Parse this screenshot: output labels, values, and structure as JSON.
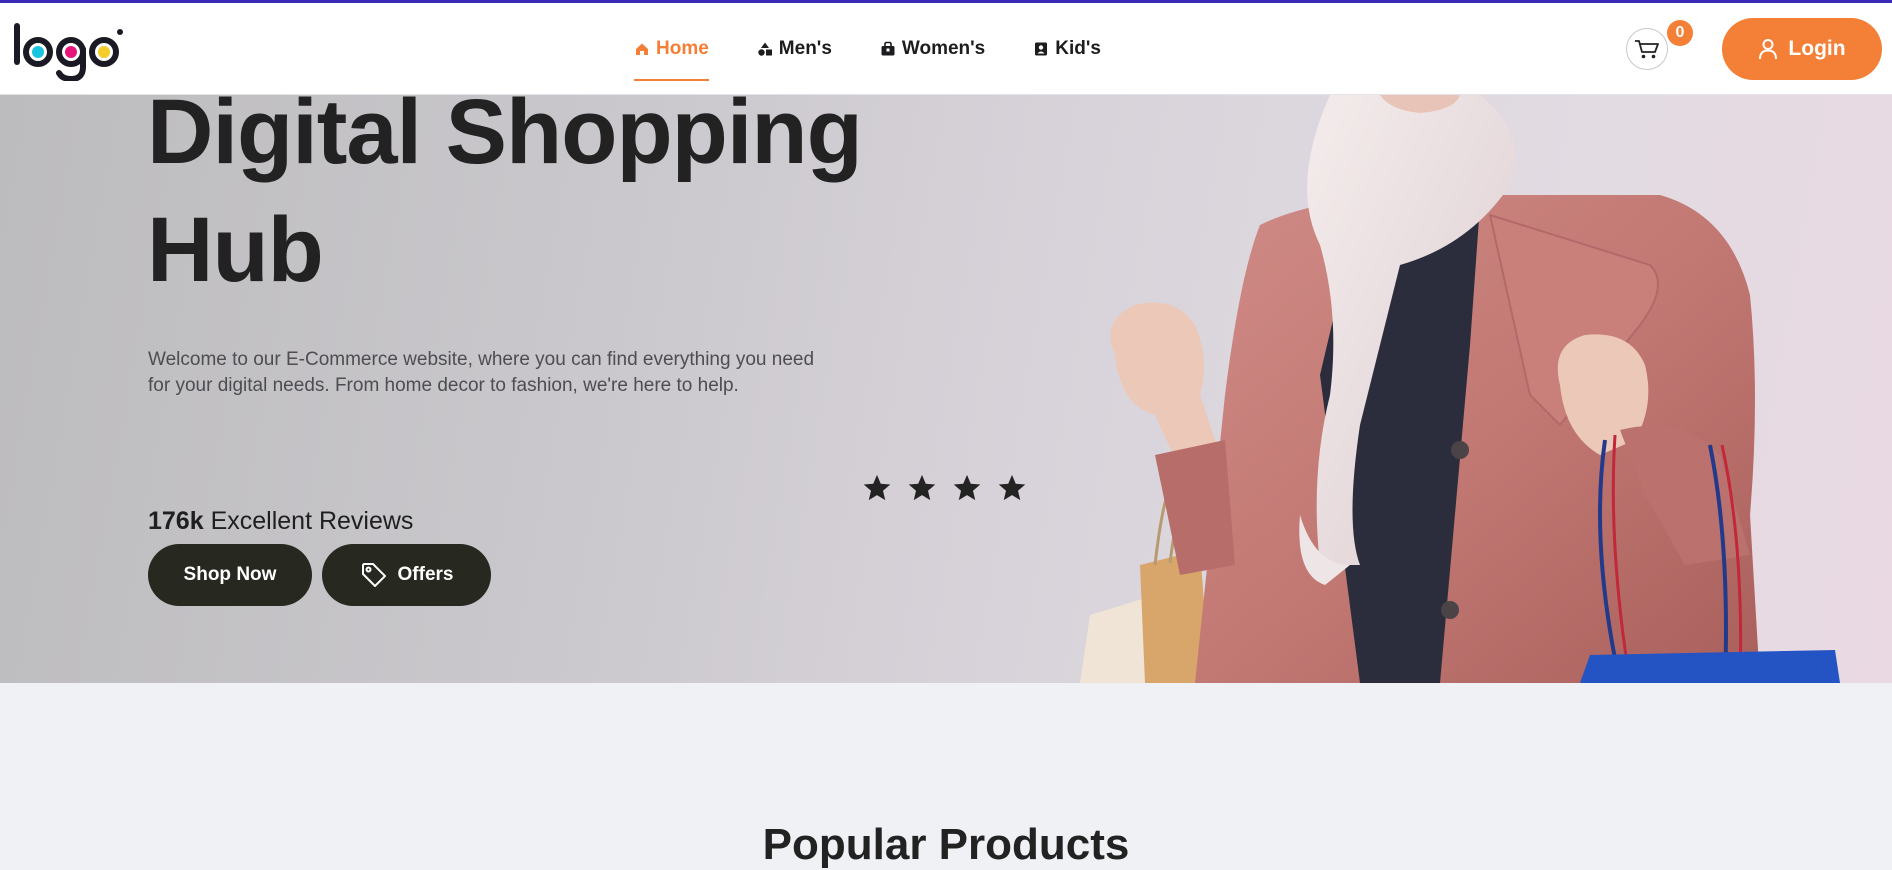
{
  "header": {
    "logo_text": "logo",
    "nav": [
      {
        "label": "Home",
        "icon": "home-icon",
        "active": true
      },
      {
        "label": "Men's",
        "icon": "shapes-icon",
        "active": false
      },
      {
        "label": "Women's",
        "icon": "bag-icon",
        "active": false
      },
      {
        "label": "Kid's",
        "icon": "contact-icon",
        "active": false
      }
    ],
    "cart_count": "0",
    "login_label": "Login"
  },
  "hero": {
    "title": "Digital Shopping Hub",
    "description": "Welcome to our E-Commerce website, where you can find everything you need for your digital needs. From home decor to fashion, we're here to help.",
    "review_count": "176k",
    "review_label": "Excellent Reviews",
    "rating_stars": 4,
    "shop_now_label": "Shop Now",
    "offers_label": "Offers"
  },
  "sections": {
    "popular_title": "Popular Products"
  },
  "colors": {
    "accent": "#f47f36",
    "dark_button": "#27281f",
    "top_line": "#3a2bb8",
    "logo_dots": [
      "#18c4e0",
      "#e6147a",
      "#f4cd2a"
    ]
  }
}
